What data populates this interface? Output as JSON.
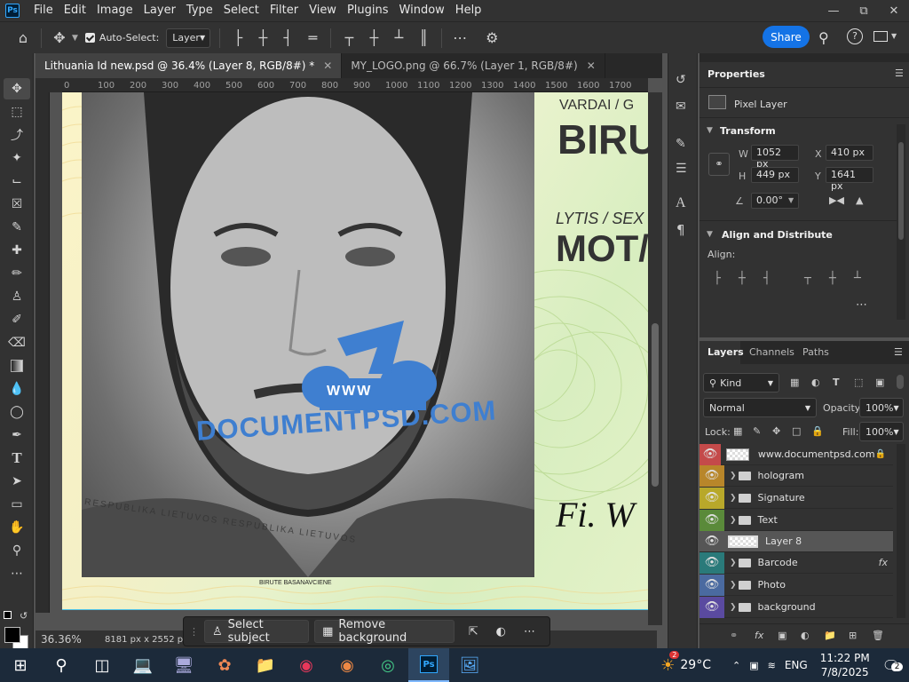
{
  "app": {
    "logo": "Ps"
  },
  "menu": [
    "File",
    "Edit",
    "Image",
    "Layer",
    "Type",
    "Select",
    "Filter",
    "View",
    "Plugins",
    "Window",
    "Help"
  ],
  "options": {
    "auto_select_label": "Auto-Select:",
    "auto_select_value": "Layer",
    "share_label": "Share"
  },
  "tabs": [
    {
      "label": "Lithuania Id new.psd @ 36.4% (Layer 8, RGB/8#) *",
      "active": true
    },
    {
      "label": "MY_LOGO.png @ 66.7% (Layer 1, RGB/8#)",
      "active": false
    }
  ],
  "ruler": [
    "0",
    "100",
    "200",
    "300",
    "400",
    "500",
    "600",
    "700",
    "800",
    "900",
    "1000",
    "1100",
    "1200",
    "1300",
    "1400",
    "1500",
    "1600",
    "1700"
  ],
  "document": {
    "field1_label": "VARDAI / G",
    "field1_value": "BIRU",
    "field2_label": "LYTIS / SEX",
    "field2_value": "MOT/",
    "watermark": "DOCUMENTPSD.COM",
    "watermark_small": "WWW",
    "caption": "BIRUTE BASANAVCIENE",
    "micro_text": "RESPUBLIKA LIETUVOS RESPUBLIKA LIETUVOS",
    "signature": "Fi. W"
  },
  "status": {
    "zoom": "36.36%",
    "doc_size": "8181 px x 2552 px (1"
  },
  "context_bar": {
    "select_subject": "Select subject",
    "remove_background": "Remove background"
  },
  "properties": {
    "title": "Properties",
    "layer_type": "Pixel Layer",
    "transform_title": "Transform",
    "w_label": "W",
    "w_value": "1052 px",
    "x_label": "X",
    "x_value": "410 px",
    "h_label": "H",
    "h_value": "449 px",
    "y_label": "Y",
    "y_value": "1641 px",
    "angle_value": "0.00°",
    "align_title": "Align and Distribute",
    "align_label": "Align:"
  },
  "layers_panel": {
    "tabs": [
      "Layers",
      "Channels",
      "Paths"
    ],
    "kind_label": "Kind",
    "blend_mode": "Normal",
    "opacity_label": "Opacity:",
    "opacity_value": "100%",
    "lock_label": "Lock:",
    "fill_label": "Fill:",
    "fill_value": "100%",
    "layers": [
      {
        "name": "www.documentpsd.com",
        "type": "pixel",
        "color": "#c44a4a",
        "locked": true
      },
      {
        "name": "hologram",
        "type": "group",
        "color": "#b8862a"
      },
      {
        "name": "Signature",
        "type": "group",
        "color": "#b8a82a"
      },
      {
        "name": "Text",
        "type": "group",
        "color": "#5a8a3a"
      },
      {
        "name": "Layer 8",
        "type": "pixel",
        "color": "",
        "selected": true
      },
      {
        "name": "Barcode",
        "type": "group",
        "color": "#2a7a7a",
        "fx": "fx"
      },
      {
        "name": "Photo",
        "type": "group",
        "color": "#4a6aa0"
      },
      {
        "name": "background",
        "type": "group",
        "color": "#5a4aa0"
      }
    ]
  },
  "taskbar": {
    "temperature": "29°C",
    "language": "ENG",
    "time": "11:22 PM",
    "date": "7/8/2025",
    "weather_badge": "2",
    "notification_badge": "2"
  }
}
